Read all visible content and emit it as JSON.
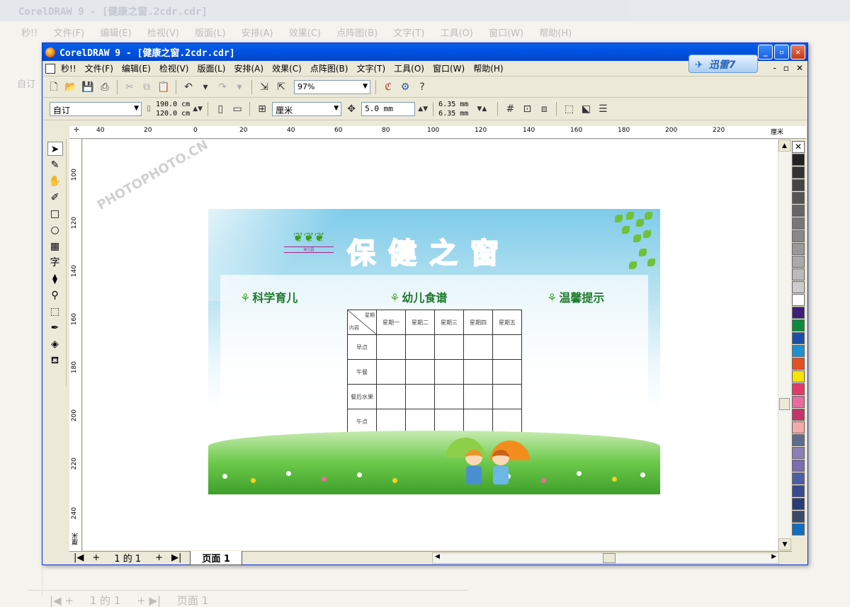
{
  "background_window": {
    "title": "CorelDRAW 9 - [健康之窗.2cdr.cdr]",
    "menu": [
      "秒!!",
      "文件(F)",
      "编辑(E)",
      "检视(V)",
      "版面(L)",
      "安排(A)",
      "效果(C)",
      "点阵图(B)",
      "文字(T)",
      "工具(O)",
      "窗口(W)",
      "帮助(H)"
    ],
    "style_value": "自订",
    "bottom": {
      "page_info": "1 的 1",
      "page_tab": "页面 1"
    }
  },
  "window": {
    "title": "CorelDRAW 9 - [健康之窗.2cdr.cdr]",
    "controls": {
      "minimize": "_",
      "maximize": "▫",
      "close": "✕"
    }
  },
  "menubar": {
    "items": [
      "秒!!",
      "文件(F)",
      "编辑(E)",
      "检视(V)",
      "版面(L)",
      "安排(A)",
      "效果(C)",
      "点阵图(B)",
      "文字(T)",
      "工具(O)",
      "窗口(W)",
      "帮助(H)"
    ],
    "mdi_controls": [
      "-",
      "▫",
      "✕"
    ]
  },
  "xunlei": {
    "label": "迅雷7"
  },
  "toolbar1": {
    "zoom": "97%"
  },
  "toolbar2": {
    "paper": "自订",
    "width": "190.0 cm",
    "height": "120.0 cm",
    "units": "厘米",
    "nudge": "5.0 mm",
    "dup_x": "6.35 mm",
    "dup_y": "6.35 mm"
  },
  "rulers": {
    "h_ticks": [
      "40",
      "20",
      "0",
      "20",
      "40",
      "60",
      "80",
      "100",
      "120",
      "140",
      "160",
      "180",
      "200",
      "220"
    ],
    "h_unit": "厘米",
    "v_ticks": [
      "100",
      "120",
      "140",
      "160",
      "180",
      "200",
      "220",
      "240"
    ],
    "v_unit": "厘米"
  },
  "statusbar": {
    "page_info": "1 的 1",
    "page_tab": "页面 1"
  },
  "artwork": {
    "title_chars": [
      "保",
      "健",
      "之",
      "窗"
    ],
    "logo_caption": "幼儿园",
    "sections": [
      "科学育儿",
      "幼儿食谱",
      "温馨提示"
    ],
    "table": {
      "corner_top": "星期",
      "corner_bottom": "内容",
      "days": [
        "星期一",
        "星期二",
        "星期三",
        "星期四",
        "星期五"
      ],
      "rows": [
        "早点",
        "午餐",
        "餐后水果",
        "午点"
      ]
    }
  },
  "watermarks": [
    "PHOTOPHOTO.CN",
    "PHOTOPHOTO.CN"
  ],
  "palette": [
    "#222222",
    "#333333",
    "#444444",
    "#555555",
    "#666666",
    "#777777",
    "#888888",
    "#999999",
    "#aaaaaa",
    "#bbbbbb",
    "#cccccc",
    "#ffffff",
    "#3b1f7a",
    "#0d8a3b",
    "#1a4fa8",
    "#1e90d0",
    "#e65020",
    "#f7e300",
    "#e23a6a",
    "#e86aa0",
    "#c4346a",
    "#f5a9a9",
    "#5f6a8f",
    "#8a7fb8",
    "#7a6db0",
    "#4f5da8",
    "#3a4a90",
    "#2b3a78",
    "#3a4a6a",
    "#1070c0"
  ]
}
